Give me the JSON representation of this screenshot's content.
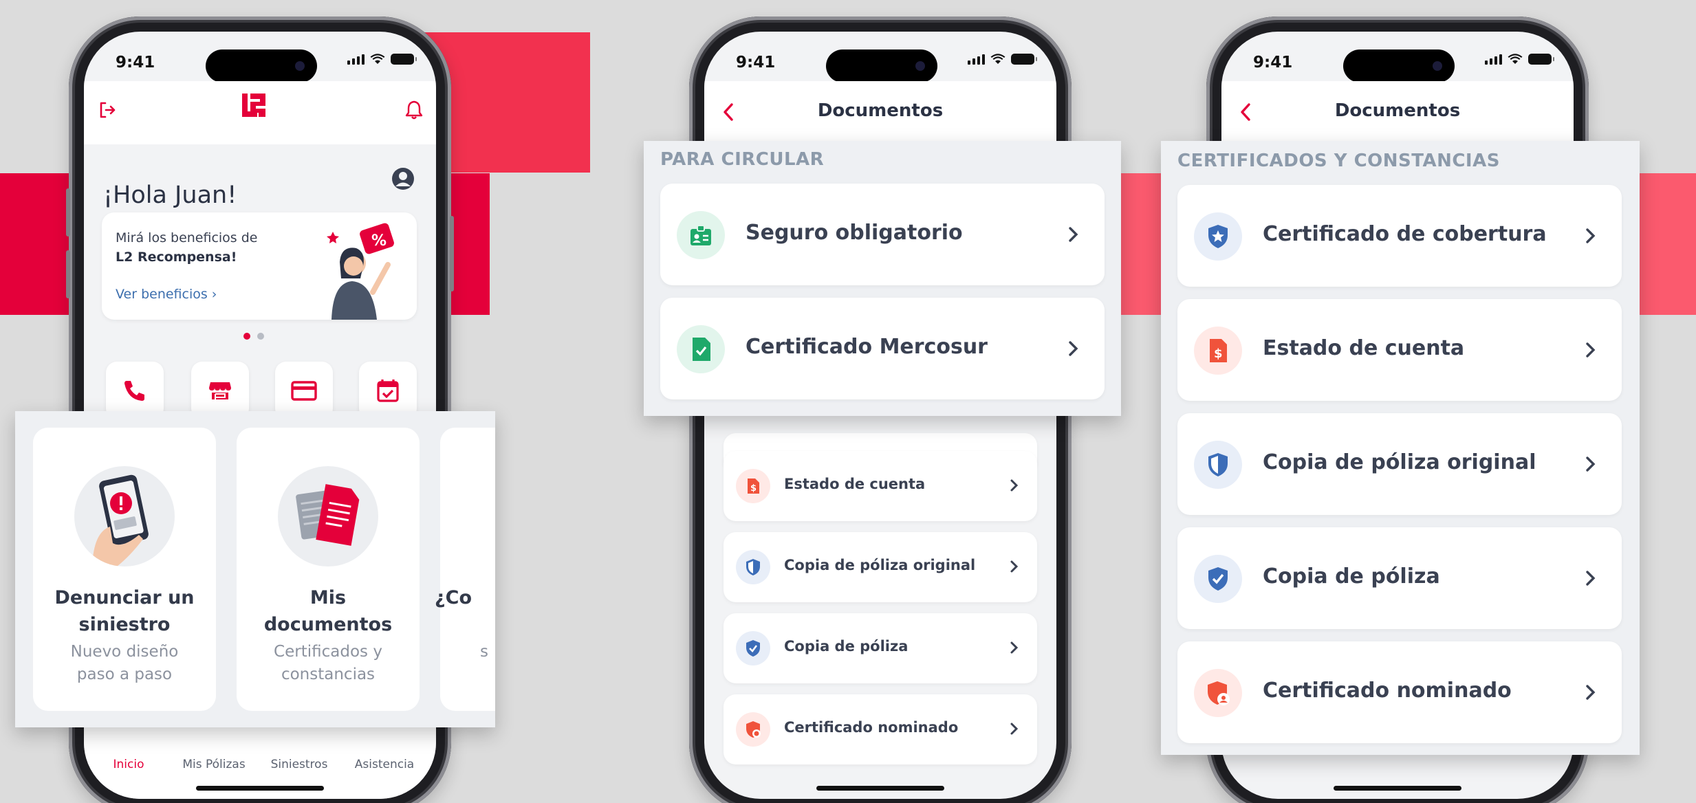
{
  "colors": {
    "brand": "#e4003a",
    "brand_light": "#f2405c",
    "background": "#dcdcdc",
    "text": "#3a4152"
  },
  "status_bar": {
    "time": "9:41"
  },
  "screen_home": {
    "greeting": "¡Hola Juan!",
    "promo": {
      "line1": "Mirá los beneficios de",
      "line2": "L2 Recompensa!",
      "link": "Ver beneficios"
    },
    "quick_actions": [
      "phone-icon",
      "store-icon",
      "credit-card-icon",
      "calendar-check-icon"
    ],
    "cards": [
      {
        "title_line1": "Denunciar un",
        "title_line2": "siniestro",
        "subtitle_line1": "Nuevo diseño",
        "subtitle_line2": "paso a paso",
        "icon": "phone-alert-illustration"
      },
      {
        "title_line1": "Mis",
        "title_line2": "documentos",
        "subtitle_line1": "Certificados y",
        "subtitle_line2": "constancias",
        "icon": "documents-illustration"
      },
      {
        "title_line1": "¿Co",
        "title_line2": "",
        "subtitle_line1": "s",
        "subtitle_line2": "",
        "icon": "partial-card"
      }
    ],
    "nav": [
      {
        "label": "Inicio",
        "active": true
      },
      {
        "label": "Mis Pólizas",
        "active": false
      },
      {
        "label": "Siniestros",
        "active": false
      },
      {
        "label": "Asistencia",
        "active": false
      }
    ]
  },
  "screen_docs": {
    "title": "Documentos",
    "section_circular": "PARA CIRCULAR",
    "section_certificados": "CERTIFICADOS Y CONSTANCIAS",
    "circular_items": [
      {
        "label": "Seguro obligatorio",
        "icon": "id-badge-icon"
      },
      {
        "label": "Certificado Mercosur",
        "icon": "file-check-icon"
      }
    ],
    "cert_items": [
      {
        "label": "Certificado de cobertura",
        "icon": "shield-star-icon"
      },
      {
        "label": "Estado de cuenta",
        "icon": "file-dollar-icon"
      },
      {
        "label": "Copia de póliza original",
        "icon": "shield-half-icon"
      },
      {
        "label": "Copia de póliza",
        "icon": "shield-check-icon"
      },
      {
        "label": "Certificado nominado",
        "icon": "shield-user-icon"
      }
    ]
  }
}
